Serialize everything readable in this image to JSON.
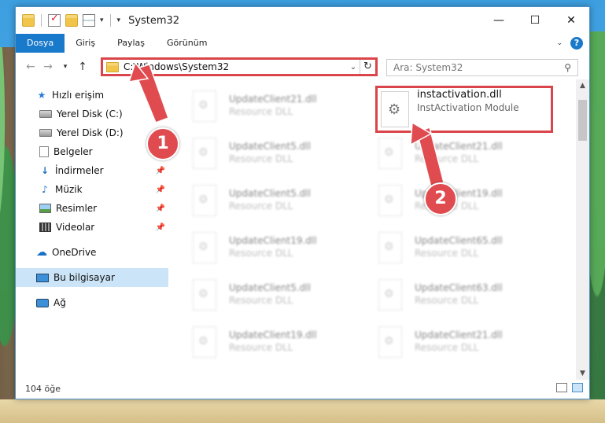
{
  "window": {
    "title": "System32"
  },
  "ribbon": {
    "tabs": [
      "Dosya",
      "Giriş",
      "Paylaş",
      "Görünüm"
    ],
    "active": 0
  },
  "address": {
    "path": "C:\\Windows\\System32",
    "search_placeholder": "Ara: System32"
  },
  "nav": {
    "items": [
      {
        "label": "Hızlı erişim",
        "icon": "star-icon"
      },
      {
        "label": "Yerel Disk (C:)",
        "icon": "drive-icon",
        "pinned": true
      },
      {
        "label": "Yerel Disk (D:)",
        "icon": "drive-icon"
      },
      {
        "label": "Belgeler",
        "icon": "document-icon"
      },
      {
        "label": "İndirmeler",
        "icon": "download-icon",
        "pinned": true
      },
      {
        "label": "Müzik",
        "icon": "music-icon",
        "pinned": true
      },
      {
        "label": "Resimler",
        "icon": "pictures-icon",
        "pinned": true
      },
      {
        "label": "Videolar",
        "icon": "videos-icon",
        "pinned": true
      },
      {
        "label": "OneDrive",
        "icon": "cloud-icon"
      },
      {
        "label": "Bu bilgisayar",
        "icon": "computer-icon",
        "selected": true
      },
      {
        "label": "Ağ",
        "icon": "network-icon"
      }
    ]
  },
  "files": {
    "highlight": {
      "name": "instactivation.dll",
      "type": "InstActivation Module"
    },
    "left_col": [
      {
        "name": "UpdateClient21.dll",
        "type": "Resource DLL"
      },
      {
        "name": "UpdateClient5.dll",
        "type": "Resource DLL"
      },
      {
        "name": "UpdateClient5.dll",
        "type": "Resource DLL"
      },
      {
        "name": "UpdateClient19.dll",
        "type": "Resource DLL"
      },
      {
        "name": "UpdateClient5.dll",
        "type": "Resource DLL"
      },
      {
        "name": "UpdateClient19.dll",
        "type": "Resource DLL"
      }
    ],
    "right_col": [
      {
        "name": "UpdateClient21.dll",
        "type": "Resource DLL"
      },
      {
        "name": "UpdateClient19.dll",
        "type": "Resource DLL"
      },
      {
        "name": "UpdateClient65.dll",
        "type": "Resource DLL"
      },
      {
        "name": "UpdateClient63.dll",
        "type": "Resource DLL"
      },
      {
        "name": "UpdateClient21.dll",
        "type": "Resource DLL"
      }
    ]
  },
  "status": {
    "count": "104 öğe"
  },
  "annotations": {
    "step1": "1",
    "step2": "2",
    "color": "#e04b50"
  }
}
